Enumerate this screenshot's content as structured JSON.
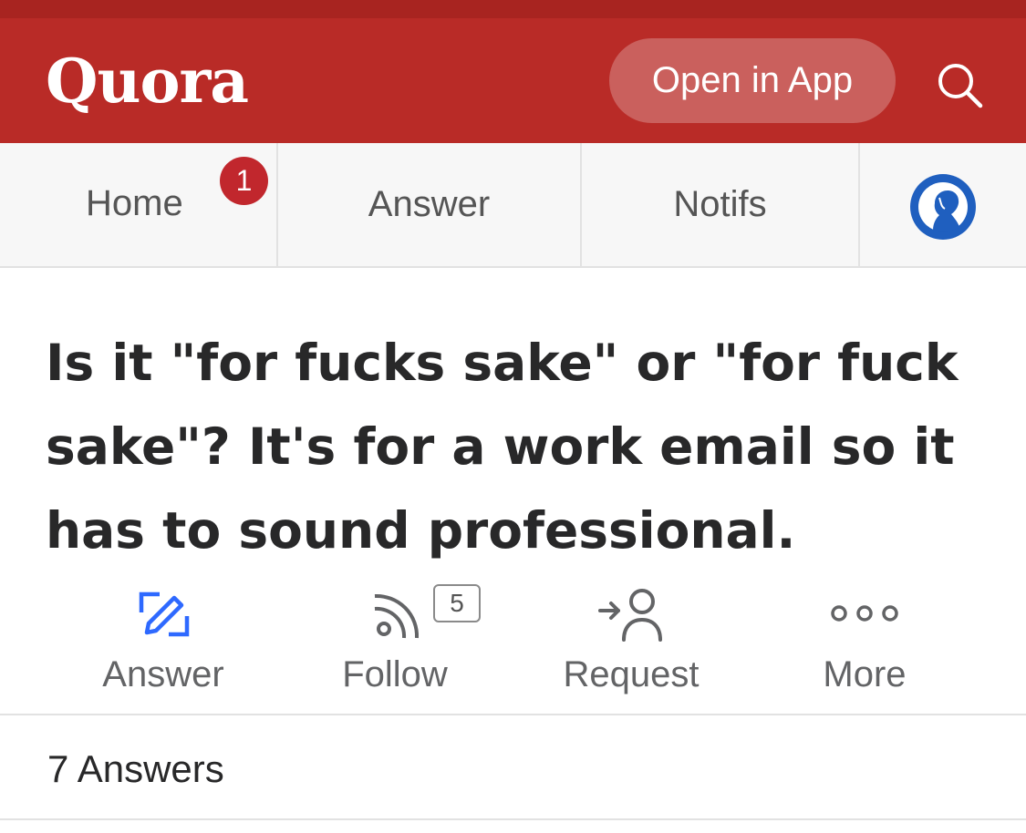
{
  "header": {
    "logo": "Quora",
    "open_app_label": "Open in App",
    "search_icon": "search-icon",
    "background_color": "#b92b27"
  },
  "nav": {
    "home_label": "Home",
    "home_badge": "1",
    "answer_label": "Answer",
    "notifs_label": "Notifs",
    "profile_icon": "avatar-icon"
  },
  "question": {
    "title": "Is it \"for fucks sake\" or \"for fuck sake\"? It's for a work email so it has to sound professional."
  },
  "actions": {
    "answer_label": "Answer",
    "follow_label": "Follow",
    "follow_count": "5",
    "request_label": "Request",
    "more_label": "More",
    "accent_color": "#2e69ff"
  },
  "answers": {
    "count_label": "7 Answers"
  }
}
